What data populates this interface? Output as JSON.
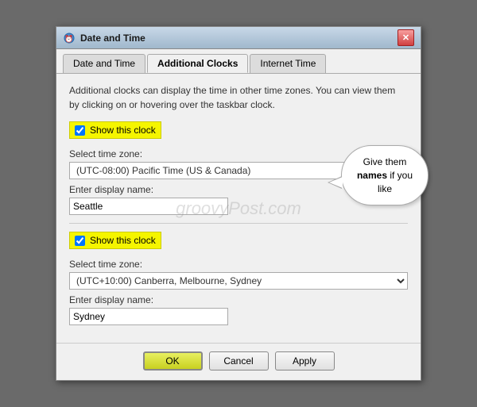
{
  "window": {
    "title": "Date and Time",
    "close_label": "✕"
  },
  "tabs": [
    {
      "id": "date-time",
      "label": "Date and Time",
      "active": false
    },
    {
      "id": "additional-clocks",
      "label": "Additional Clocks",
      "active": true
    },
    {
      "id": "internet-time",
      "label": "Internet Time",
      "active": false
    }
  ],
  "description": "Additional clocks can display the time in other time zones. You can view them by clicking on or hovering over the taskbar clock.",
  "callout": {
    "text_before": "Give them ",
    "text_bold": "names",
    "text_after": " if you like"
  },
  "clock1": {
    "checkbox_label": "Show this clock",
    "checked": true,
    "timezone_label": "Select time zone:",
    "timezone_value": "(UTC-08:00) Pacific Time (US & Canada)",
    "name_label": "Enter display name:",
    "name_value": "Seattle"
  },
  "clock2": {
    "checkbox_label": "Show this clock",
    "checked": true,
    "timezone_label": "Select time zone:",
    "timezone_value": "(UTC+10:00) Canberra, Melbourne, Sydney",
    "name_label": "Enter display name:",
    "name_value": "Sydney"
  },
  "buttons": {
    "ok": "OK",
    "cancel": "Cancel",
    "apply": "Apply"
  },
  "watermark": "groovyPost.com"
}
